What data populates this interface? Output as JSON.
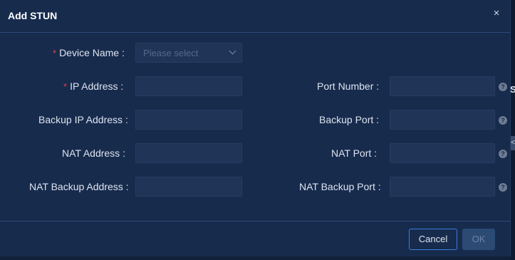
{
  "dialog": {
    "title": "Add STUN",
    "close_glyph": "×"
  },
  "form": {
    "required_mark": "*",
    "device_name": {
      "label": "Device Name :",
      "placeholder": "Please select",
      "value": ""
    },
    "ip_address": {
      "label": "IP Address :",
      "value": ""
    },
    "port_number": {
      "label": "Port Number :",
      "value": ""
    },
    "backup_ip_address": {
      "label": "Backup IP Address :",
      "value": ""
    },
    "backup_port": {
      "label": "Backup Port :",
      "value": ""
    },
    "nat_address": {
      "label": "NAT Address :",
      "value": ""
    },
    "nat_port": {
      "label": "NAT Port :",
      "value": ""
    },
    "nat_backup_address": {
      "label": "NAT Backup Address :",
      "value": ""
    },
    "nat_backup_port": {
      "label": "NAT Backup Port :",
      "value": ""
    },
    "help_glyph": "?"
  },
  "footer": {
    "cancel_label": "Cancel",
    "ok_label": "OK"
  },
  "background_edge": {
    "letter": "S",
    "tab_glyph": "<"
  },
  "colors": {
    "dialog_bg": "#172b4d",
    "input_bg": "#1f3457",
    "accent_border": "#3a7ed8",
    "required": "#e0424a"
  }
}
